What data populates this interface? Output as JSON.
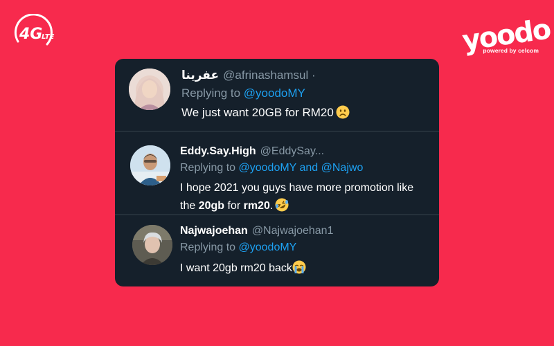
{
  "logos": {
    "left": "4G LTE",
    "brand": "yoodo",
    "brand_tagline": "powered by celcom"
  },
  "tweets": [
    {
      "name": "عفرينا",
      "handle": "@afrinashamsul ·",
      "reply_prefix": "Replying to",
      "reply_to": "@yoodoMY",
      "text": "We just want 20GB for RM20",
      "emoji": "frowning-face-icon"
    },
    {
      "name": "Eddy.Say.High",
      "handle": "@EddySay...",
      "reply_prefix": "Replying to",
      "reply_to": "@yoodoMY and @Najwo",
      "text_part1": "I hope 2021 you guys have more promotion like the ",
      "text_bold1": "20gb",
      "text_part2": " for ",
      "text_bold2": "rm20",
      "text_part3": ".",
      "emoji": "rolling-laughing-icon"
    },
    {
      "name": "Najwajoehan",
      "handle": "@Najwajoehan1",
      "reply_prefix": "Replying to",
      "reply_to": "@yoodoMY",
      "text": "I want 20gb rm20 back",
      "emoji": "loudly-crying-icon"
    }
  ],
  "colors": {
    "background": "#f72a4d",
    "card": "#15202b",
    "divider": "#38444d",
    "secondary_text": "#8899a6",
    "mention": "#1da1f2"
  }
}
